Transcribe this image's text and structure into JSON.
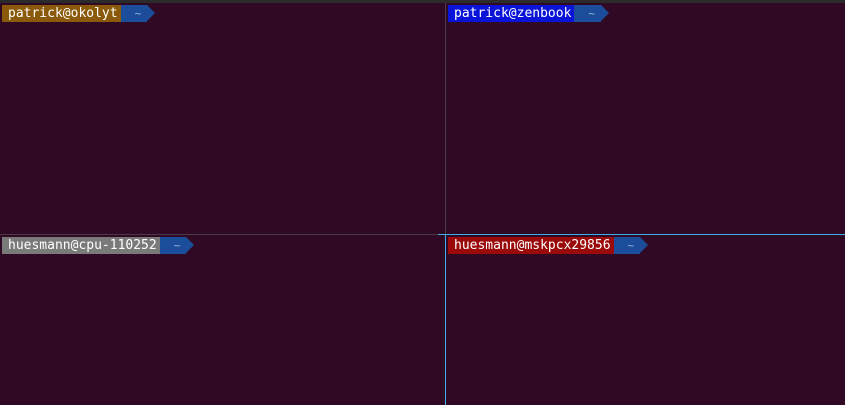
{
  "colors": {
    "background": "#300a24",
    "active_divider": "#3daee9",
    "dir_segment": "#1c4d9a"
  },
  "panes": {
    "top_left": {
      "user_host": "patrick@okolyt",
      "dir": "~",
      "color": "#8a5a0a"
    },
    "top_right": {
      "user_host": "patrick@zenbook",
      "dir": "~",
      "color": "#0a14d8"
    },
    "bottom_left": {
      "user_host": "huesmann@cpu-110252",
      "dir": "~",
      "color": "#7a7a7a"
    },
    "bottom_right": {
      "user_host": "huesmann@mskpcx29856",
      "dir": "~",
      "color": "#9a0a0a"
    }
  }
}
